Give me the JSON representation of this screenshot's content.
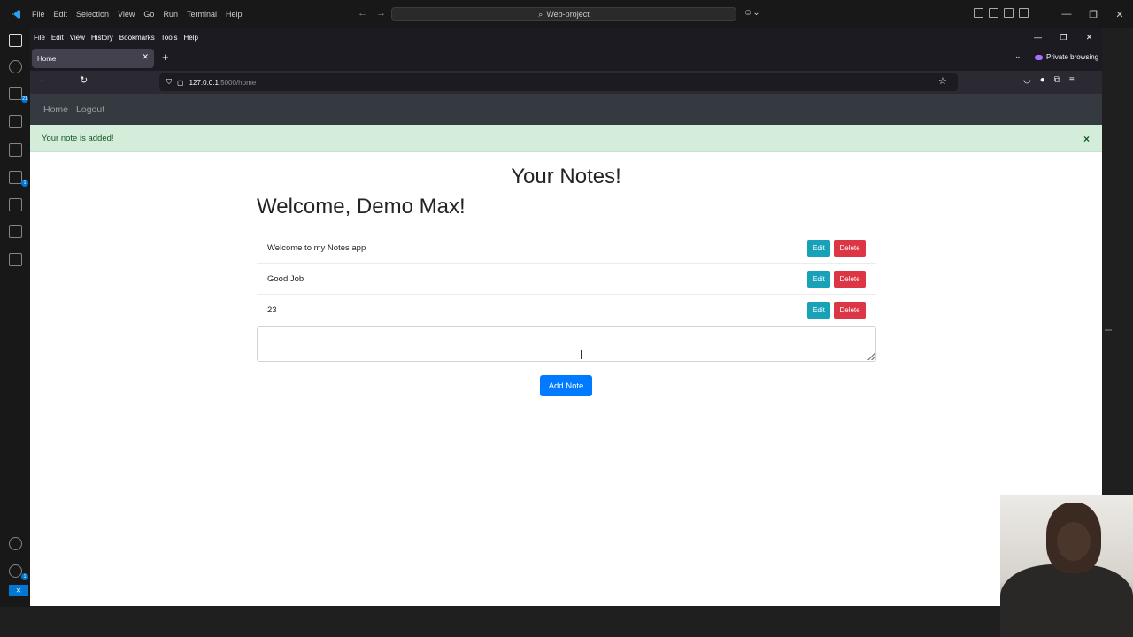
{
  "vscode": {
    "menu": [
      "File",
      "Edit",
      "Selection",
      "View",
      "Go",
      "Run",
      "Terminal",
      "Help"
    ],
    "search": "Web-project",
    "badges": {
      "source_control": "21",
      "extensions": "1",
      "accounts": "1"
    }
  },
  "firefox": {
    "menu": [
      "File",
      "Edit",
      "View",
      "History",
      "Bookmarks",
      "Tools",
      "Help"
    ],
    "tab_title": "Home",
    "private_label": "Private browsing",
    "url_host": "127.0.0.1",
    "url_rest": ":5000/home"
  },
  "app": {
    "nav": [
      "Home",
      "Logout"
    ],
    "alert": "Your note is added!",
    "alert_close": "×",
    "page_title": "Your Notes!",
    "welcome": "Welcome, Demo Max!",
    "notes": [
      {
        "text": "Welcome to my Notes app"
      },
      {
        "text": "Good Job"
      },
      {
        "text": "23"
      }
    ],
    "edit_label": "Edit",
    "delete_label": "Delete",
    "note_input_value": "",
    "add_button": "Add Note"
  },
  "colors": {
    "navbar": "#343a40",
    "alert_bg": "#d4edda",
    "alert_text": "#155724",
    "edit": "#17a2b8",
    "delete": "#dc3545",
    "primary": "#007bff"
  }
}
